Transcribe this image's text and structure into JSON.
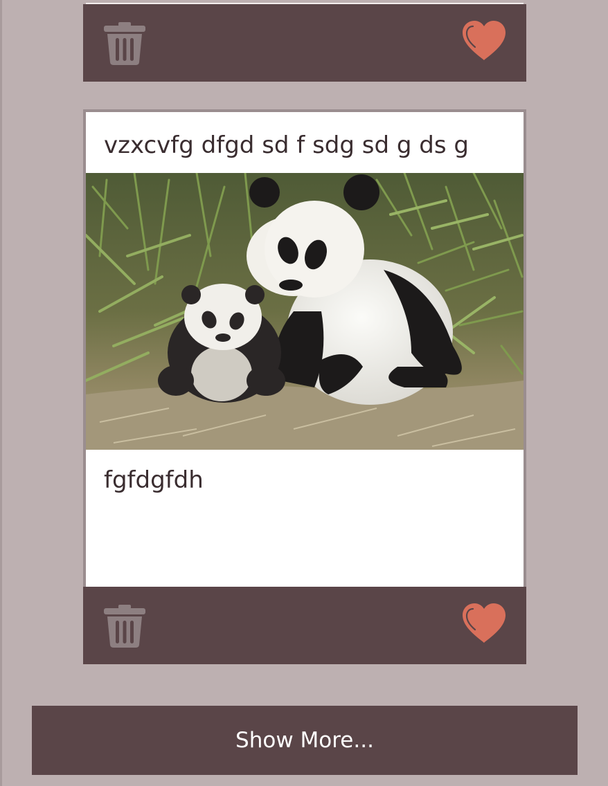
{
  "colors": {
    "page_background": "#bdb0b1",
    "bar_background": "#5a4548",
    "heart": "#d9705b",
    "trash": "#8d7f81",
    "text": "#3a2d30",
    "button_text": "#ffffff"
  },
  "top_post": {
    "actions": {
      "delete_icon": "trash-icon",
      "favorite_icon": "heart-icon"
    }
  },
  "post": {
    "title": "vzxcvfg dfgd sd f sdg sd g ds g",
    "image": "panda-mother-and-cub-photo",
    "body": "fgfdgfdh",
    "actions": {
      "delete_icon": "trash-icon",
      "favorite_icon": "heart-icon"
    }
  },
  "show_more": {
    "label": "Show More..."
  }
}
